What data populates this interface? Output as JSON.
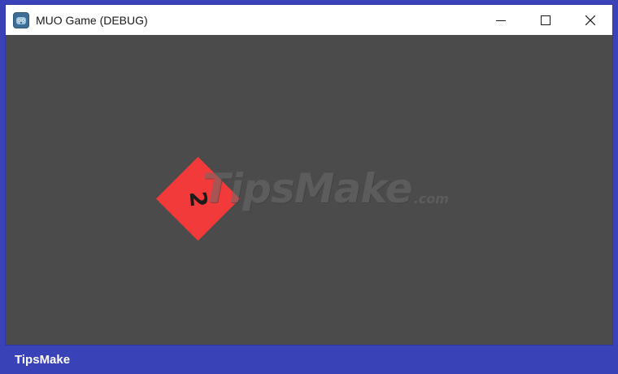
{
  "window": {
    "title": "MUO Game (DEBUG)",
    "app_icon": "godot-engine-icon",
    "controls": {
      "minimize_icon": "minimize-icon",
      "maximize_icon": "maximize-icon",
      "close_icon": "close-icon"
    }
  },
  "game": {
    "background_color": "#4b4b4b",
    "sprite": {
      "label": "2",
      "color": "#f23a3a"
    }
  },
  "watermark": {
    "main": "TipsMake",
    "suffix": ".com"
  },
  "footer": {
    "brand": "TipsMake",
    "color": "#3a42b8"
  }
}
